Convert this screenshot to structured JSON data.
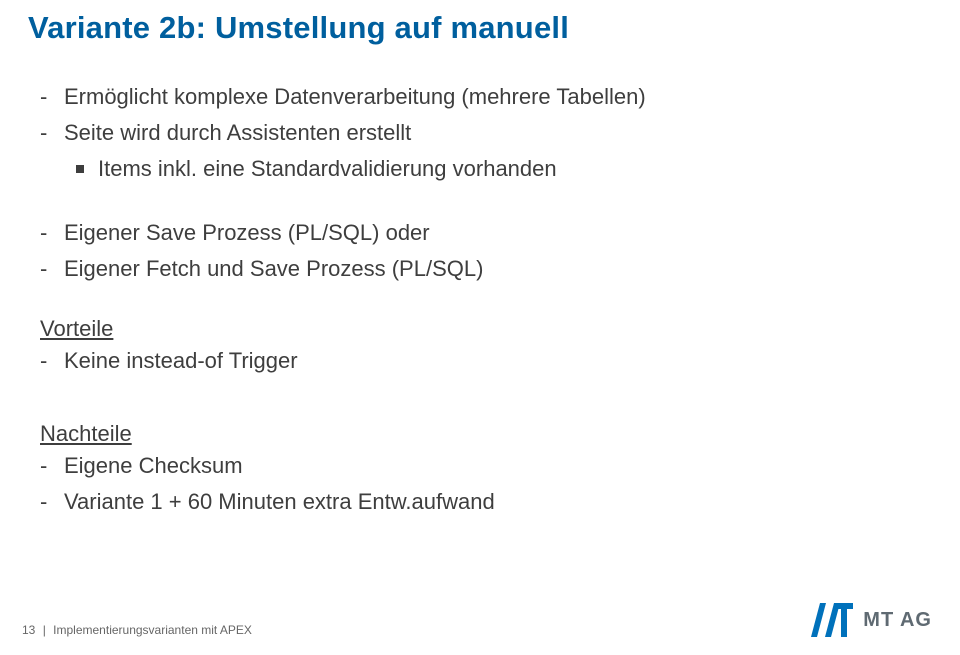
{
  "title": "Variante 2b: Umstellung auf manuell",
  "bullets": {
    "b1": "Ermöglicht komplexe Datenverarbeitung (mehrere Tabellen)",
    "b2": "Seite wird durch Assistenten erstellt",
    "b2_1": "Items inkl. eine Standardvalidierung vorhanden",
    "b3": "Eigener Save Prozess (PL/SQL) oder",
    "b4": "Eigener Fetch und Save Prozess (PL/SQL)"
  },
  "sections": {
    "advantages_heading": "Vorteile",
    "adv1": "Keine instead-of Trigger",
    "disadvantages_heading": "Nachteile",
    "dis1": "Eigene Checksum",
    "dis2": "Variante 1 + 60 Minuten extra Entw.aufwand"
  },
  "footer": {
    "page_number": "13",
    "separator": "|",
    "footer_text": "Implementierungsvarianten mit APEX"
  },
  "logo": {
    "text": "MT AG"
  }
}
